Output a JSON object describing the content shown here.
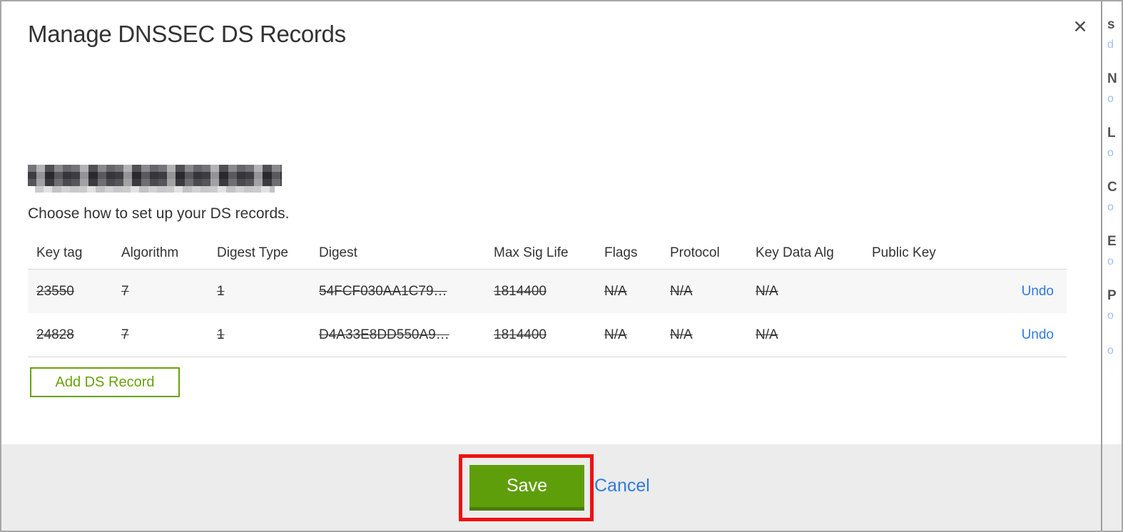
{
  "modal": {
    "title": "Manage DNSSEC DS Records",
    "close_icon": "✕",
    "domain_redacted": true,
    "subtitle": "Choose how to set up your DS records.",
    "table": {
      "headers": [
        "Key tag",
        "Algorithm",
        "Digest Type",
        "Digest",
        "Max Sig Life",
        "Flags",
        "Protocol",
        "Key Data Alg",
        "Public Key"
      ],
      "rows": [
        {
          "key_tag": "23550",
          "algorithm": "7",
          "digest_type": "1",
          "digest": "54FCF030AA1C79…",
          "max_sig_life": "1814400",
          "flags": "N/A",
          "protocol": "N/A",
          "key_data_alg": "N/A",
          "public_key": "",
          "action": "Undo",
          "state": "marked-for-deletion"
        },
        {
          "key_tag": "24828",
          "algorithm": "7",
          "digest_type": "1",
          "digest": "D4A33E8DD550A9…",
          "max_sig_life": "1814400",
          "flags": "N/A",
          "protocol": "N/A",
          "key_data_alg": "N/A",
          "public_key": "",
          "action": "Undo",
          "state": "marked-for-deletion"
        }
      ]
    },
    "add_button_label": "Add DS Record",
    "footer": {
      "save_label": "Save",
      "cancel_label": "Cancel"
    }
  },
  "annotation": {
    "shape": "red-rectangle-highlight",
    "color": "#ef1111",
    "target": "save-button"
  },
  "colors": {
    "accent_green": "#5f9e0b",
    "outline_green": "#6aa10d",
    "link_blue": "#2f7be0",
    "footer_gray": "#ececec",
    "row_stripe": "#f7f7f7",
    "text": "#333333"
  },
  "background_strip": {
    "headings": [
      "s",
      "N",
      "L",
      "C",
      "E",
      "P"
    ],
    "links": [
      "d",
      "o",
      "o",
      "o",
      "o",
      "o",
      "o"
    ]
  }
}
